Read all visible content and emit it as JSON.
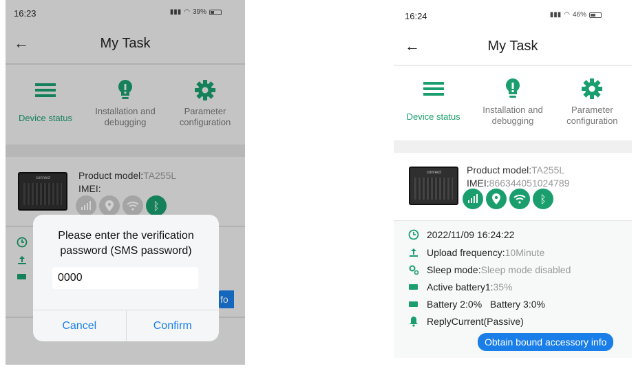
{
  "left_screen": {
    "status_bar": {
      "time": "16:23",
      "battery": "39%"
    },
    "app_bar": {
      "title": "My Task"
    },
    "tabs": [
      {
        "label": "Device status",
        "icon": "menu-icon"
      },
      {
        "label": "Installation and debugging",
        "icon": "bulb-icon"
      },
      {
        "label": "Parameter configuration",
        "icon": "gear-icon"
      }
    ],
    "device": {
      "model_label": "Product model:",
      "model_value": "TA255L",
      "imei_label": "IMEI:",
      "imei_value": ""
    },
    "partial_button_text": "fo",
    "dialog": {
      "message": "Please enter the verification password (SMS password)",
      "input_value": "0000",
      "cancel_label": "Cancel",
      "confirm_label": "Confirm"
    }
  },
  "right_screen": {
    "status_bar": {
      "time": "16:24",
      "battery": "46%"
    },
    "app_bar": {
      "title": "My Task"
    },
    "tabs": [
      {
        "label": "Device status",
        "icon": "menu-icon"
      },
      {
        "label": "Installation and debugging",
        "icon": "bulb-icon"
      },
      {
        "label": "Parameter configuration",
        "icon": "gear-icon"
      }
    ],
    "device": {
      "model_label": "Product model:",
      "model_value": "TA255L",
      "imei_label": "IMEI:",
      "imei_value": "866344051024789"
    },
    "details": {
      "datetime": "2022/11/09 16:24:22",
      "upload_label": "Upload frequency:",
      "upload_value": "10Minute",
      "sleep_label": "Sleep mode:",
      "sleep_value": "Sleep mode disabled",
      "battery1_label": "Active battery1:",
      "battery1_value": "35%",
      "battery23": "Battery 2:0%   Battery 3:0%",
      "reply": "ReplyCurrent(Passive)"
    },
    "obtain_button": "Obtain bound accessory info"
  },
  "colors": {
    "accent_green": "#1a9e6e",
    "accent_blue": "#1a7ee8"
  }
}
